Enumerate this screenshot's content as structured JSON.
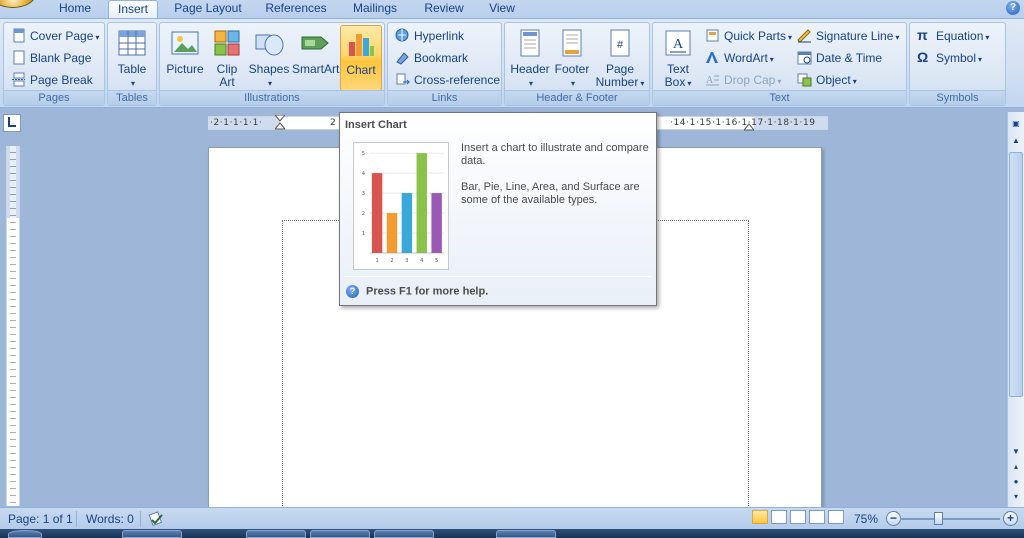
{
  "tabs": {
    "home": "Home",
    "insert": "Insert",
    "page_layout": "Page Layout",
    "references": "References",
    "mailings": "Mailings",
    "review": "Review",
    "view": "View"
  },
  "ribbon": {
    "pages": {
      "label": "Pages",
      "cover_page": "Cover Page",
      "blank_page": "Blank Page",
      "page_break": "Page Break"
    },
    "tables": {
      "label": "Tables",
      "table": "Table"
    },
    "illustrations": {
      "label": "Illustrations",
      "picture": "Picture",
      "clip_art_line1": "Clip",
      "clip_art_line2": "Art",
      "shapes": "Shapes",
      "smartart": "SmartArt",
      "chart": "Chart"
    },
    "links": {
      "label": "Links",
      "hyperlink": "Hyperlink",
      "bookmark": "Bookmark",
      "cross_reference": "Cross-reference"
    },
    "header_footer": {
      "label": "Header & Footer",
      "header": "Header",
      "footer": "Footer",
      "page_number_line1": "Page",
      "page_number_line2": "Number"
    },
    "text": {
      "label": "Text",
      "text_box_line1": "Text",
      "text_box_line2": "Box",
      "quick_parts": "Quick Parts",
      "wordart": "WordArt",
      "drop_cap": "Drop Cap",
      "signature_line": "Signature Line",
      "date_time": "Date & Time",
      "object": "Object"
    },
    "symbols": {
      "label": "Symbols",
      "equation": "Equation",
      "symbol": "Symbol"
    }
  },
  "ruler": {
    "left_numbers": "·2·1·1·1·1·",
    "left_number_2": "2",
    "right_numbers": "·14·1·15·1·16·1·17·1·18·1·19"
  },
  "tooltip": {
    "title": "Insert Chart",
    "description_1": "Insert a chart to illustrate and compare data.",
    "description_2": "Bar, Pie, Line, Area, and Surface are some of the available types.",
    "help_text": "Press F1 for more help.",
    "preview_chart": {
      "type": "bar",
      "categories": [
        "1",
        "2",
        "3",
        "4",
        "5"
      ],
      "values": [
        4,
        2,
        3,
        5,
        3
      ],
      "ylim": [
        0,
        5
      ],
      "y_ticks": [
        "5",
        "4",
        "3",
        "2",
        "1"
      ],
      "colors": [
        "#d9534f",
        "#f39c32",
        "#39a9d9",
        "#8bc34a",
        "#9b59b6"
      ]
    }
  },
  "statusbar": {
    "page": "Page: 1 of 1",
    "words": "Words: 0",
    "zoom": "75%",
    "zoom_out": "−",
    "zoom_in": "+"
  },
  "colors": {
    "ribbon_text": "#15428b",
    "highlight": "#ffc43d"
  }
}
